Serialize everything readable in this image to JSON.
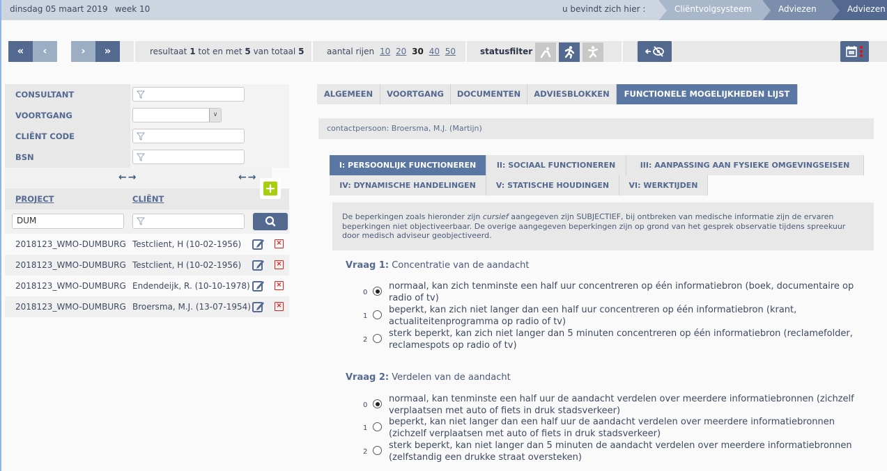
{
  "topbar": {
    "date": "dinsdag 05 maart 2019",
    "week": "week 10",
    "location_label": "u bevindt zich hier :",
    "breadcrumbs": [
      "Cliëntvolgsysteem",
      "Adviezen",
      "Adviezen"
    ]
  },
  "toolbar": {
    "first_icon": "«",
    "prev_icon": "‹",
    "next_icon": "›",
    "last_icon": "»",
    "result_prefix": "resultaat",
    "result_from": "1",
    "result_mid": "tot en met",
    "result_to": "5",
    "result_of": "van totaal",
    "result_total": "5",
    "rows_label": "aantal rijen",
    "rows_options": [
      "10",
      "20",
      "30",
      "40",
      "50"
    ],
    "rows_selected": "30",
    "statusfilter_label": "statusfilter",
    "statusfilter_active_index": 1
  },
  "filters": {
    "consultant_label": "CONSULTANT",
    "voortgang_label": "VOORTGANG",
    "client_code_label": "CLIËNT CODE",
    "bsn_label": "BSN",
    "consultant_value": "",
    "voortgang_value": "",
    "client_code_value": "",
    "bsn_value": ""
  },
  "list": {
    "col_project": "PROJECT",
    "col_client": "CLIËNT",
    "project_search": "DUM",
    "client_search": "",
    "rows": [
      {
        "project": "2018123_WMO-DUMBURG",
        "client": "Testclient, H (10-02-1956)"
      },
      {
        "project": "2018123_WMO-DUMBURG",
        "client": "Testclient, H (10-02-1956)"
      },
      {
        "project": "2018123_WMO-DUMBURG",
        "client": "Endendeijk, R. (10-10-1978)"
      },
      {
        "project": "2018123_WMO-DUMBURG",
        "client": "Broersma, M.J. (13-07-1954)"
      }
    ]
  },
  "tabs": [
    "ALGEMEEN",
    "VOORTGANG",
    "DOCUMENTEN",
    "ADVIESBLOKKEN",
    "FUNCTIONELE MOGELIJKHEDEN LIJST"
  ],
  "active_tab": 4,
  "contact": "contactpersoon: Broersma, M.J. (Martijn)",
  "subtabs": [
    "I: PERSOONLIJK FUNCTIONEREN",
    "II: SOCIAAL FUNCTIONEREN",
    "III: AANPASSING AAN FYSIEKE OMGEVINGSEISEN",
    "IV: DYNAMISCHE HANDELINGEN",
    "V: STATISCHE HOUDINGEN",
    "VI: WERKTIJDEN"
  ],
  "active_subtab": 0,
  "note": {
    "part1": "De beperkingen zoals hieronder zijn ",
    "italic": "cursief",
    "part2": " aangegeven zijn SUBJECTIEF, bij ontbreken van medische informatie zijn de ervaren beperkingen niet objectiveerbaar. De overige aangegeven beperkingen zijn op grond van het gesprek observatie tijdens spreekuur door medisch adviseur geobjectiveerd."
  },
  "questions": [
    {
      "label": "Vraag 1:",
      "title": "Concentratie van de aandacht",
      "selected": 0,
      "options": [
        {
          "num": "0",
          "text": "normaal, kan zich tenminste een half uur concentreren op één informatiebron (boek, documentaire op radio of tv)"
        },
        {
          "num": "1",
          "text": "beperkt, kan zich niet langer dan een half uur concentreren op één informatiebron (krant, actualiteitenprogramma op radio of tv)"
        },
        {
          "num": "2",
          "text": "sterk beperkt, kan zich niet langer dan 5 minuten concentreren op één informatiebron (reclamefolder, reclamespots op radio of tv)"
        }
      ]
    },
    {
      "label": "Vraag 2:",
      "title": "Verdelen van de aandacht",
      "selected": 0,
      "options": [
        {
          "num": "0",
          "text": "normaal, kan tenminste een half uur de aandacht verdelen over meerdere informatiebronnen (zichzelf verplaatsen met auto of fiets in druk stadsverkeer)"
        },
        {
          "num": "1",
          "text": "beperkt, kan niet langer dan een half uur de aandacht verdelen over meerdere informatiebronnen (zichzelf verplaatsen met auto of fiets in druk stadsverkeer)"
        },
        {
          "num": "2",
          "text": "sterk beperkt, kan niet langer dan 5 minuten de aandacht verdelen over meerdere informatiebronnen (zelfstandig een drukke straat oversteken)"
        }
      ]
    }
  ],
  "colors": {
    "primary": "#53698f",
    "primary_light": "#9caec4",
    "add_green": "#a8cf0d",
    "delete_red": "#e02020",
    "notification_red": "#e01010"
  }
}
